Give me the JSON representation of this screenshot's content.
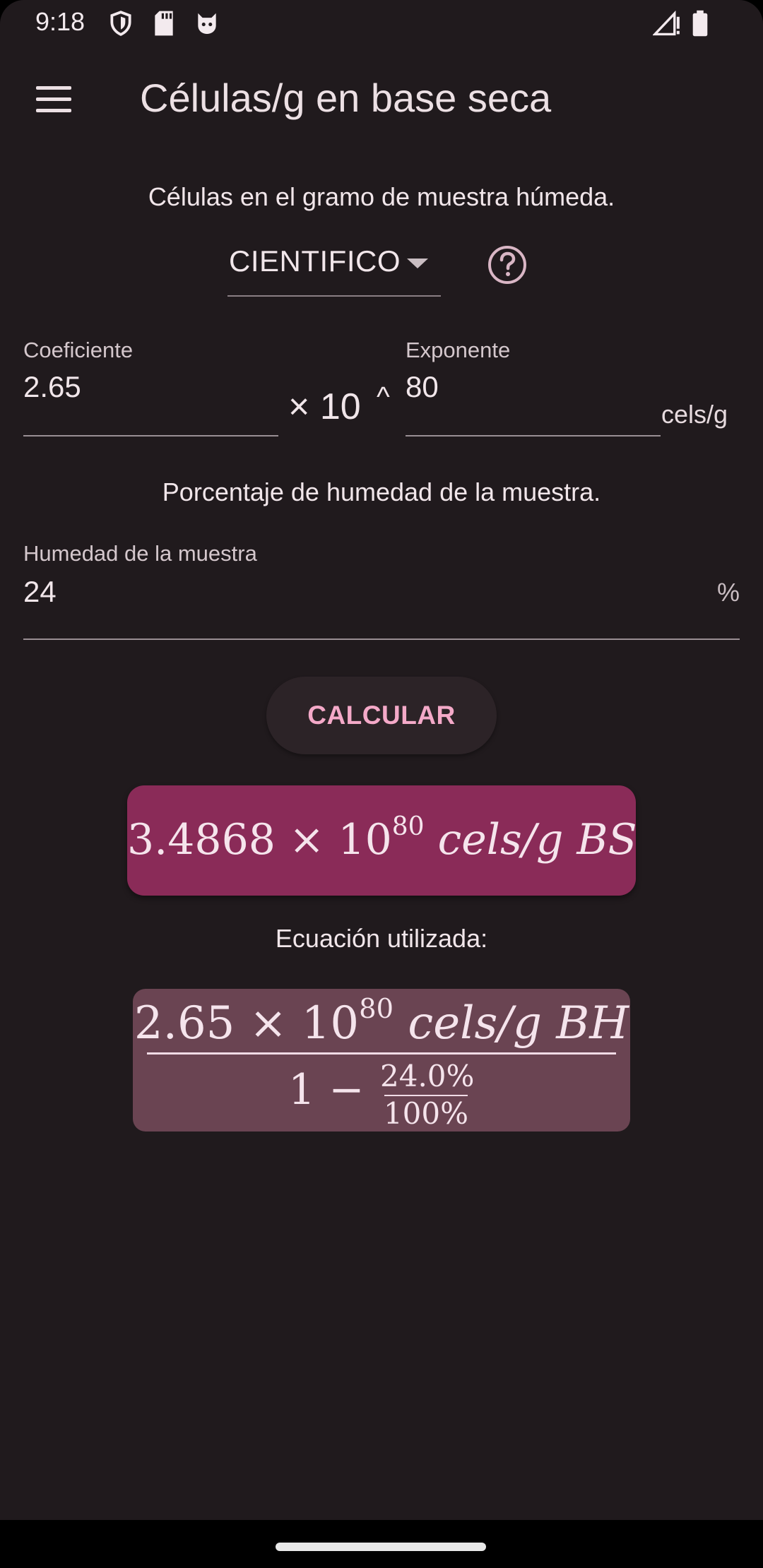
{
  "status_bar": {
    "time": "9:18",
    "left_icons": [
      "shield-icon",
      "sd-card-icon",
      "cat-face-icon"
    ],
    "right_icons": [
      "signal-alert-icon",
      "battery-icon"
    ]
  },
  "app_bar": {
    "menu_icon": "hamburger-menu-icon",
    "title": "Células/g en base seca"
  },
  "wet_section": {
    "description": "Células en el gramo de muestra húmeda.",
    "notation_selected": "CIENTIFICO",
    "help_icon": "help-circle-icon"
  },
  "coefficient_field": {
    "label": "Coeficiente",
    "value": "2.65"
  },
  "times_ten": "× 10",
  "caret": "^",
  "exponent_field": {
    "label": "Exponente",
    "value": "80"
  },
  "cells_unit": "cels/g",
  "moisture_section": {
    "description": "Porcentaje de humedad de la muestra.",
    "field_label": "Humedad de la muestra",
    "value": "24",
    "suffix": "%"
  },
  "calculate_button": "CALCULAR",
  "result": {
    "mantissa": "3.4868",
    "times": "×",
    "base": "10",
    "exponent": "80",
    "unit": "cels/g BS"
  },
  "equation_heading": "Ecuación utilizada:",
  "equation": {
    "numerator_mantissa": "2.65",
    "times": "×",
    "numerator_base": "10",
    "numerator_exponent": "80",
    "numerator_unit": "cels/g BH",
    "denominator_one": "1 −",
    "fraction_top": "24.0%",
    "fraction_bottom": "100%"
  },
  "colors": {
    "background": "#201a1d",
    "result_card": "#8a2b58",
    "equation_card": "#6a4452",
    "button_text": "#f4a9c8"
  }
}
